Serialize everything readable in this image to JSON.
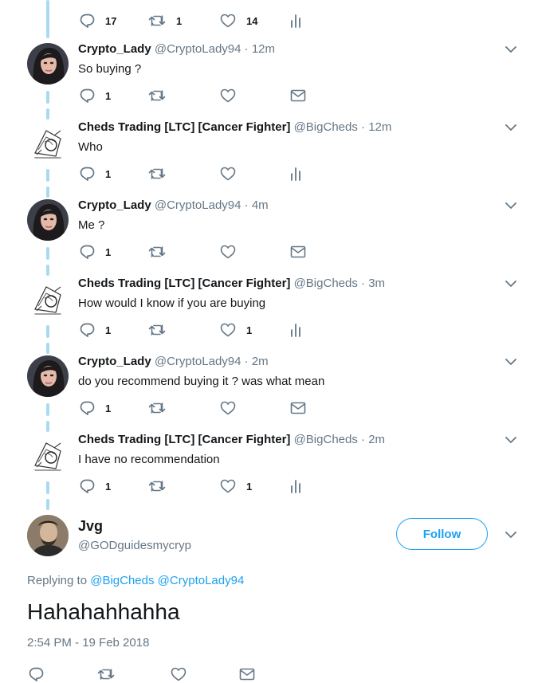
{
  "top_actions": {
    "replies": "17",
    "retweets": "1",
    "likes": "14"
  },
  "replies": [
    {
      "name": "Crypto_Lady",
      "handle": "@CryptoLady94",
      "time": "· 12m",
      "text": "So buying ?",
      "reply_count": "1",
      "like_count": "",
      "avatar": "crypto-lady",
      "extra_icon": "dm-icon"
    },
    {
      "name": "Cheds Trading [LTC] [Cancer Fighter]",
      "handle": "@BigCheds",
      "time": "· 12m",
      "text": "Who",
      "reply_count": "1",
      "like_count": "",
      "avatar": "cheds",
      "extra_icon": "analytics-icon"
    },
    {
      "name": "Crypto_Lady",
      "handle": "@CryptoLady94",
      "time": "· 4m",
      "text": "Me ?",
      "reply_count": "1",
      "like_count": "",
      "avatar": "crypto-lady",
      "extra_icon": "dm-icon"
    },
    {
      "name": "Cheds Trading [LTC] [Cancer Fighter]",
      "handle": "@BigCheds",
      "time": "· 3m",
      "text": "How would I know if you are buying",
      "reply_count": "1",
      "like_count": "1",
      "avatar": "cheds",
      "extra_icon": "analytics-icon"
    },
    {
      "name": "Crypto_Lady",
      "handle": "@CryptoLady94",
      "time": "· 2m",
      "text": "do you recommend buying it ? was what mean",
      "reply_count": "1",
      "like_count": "",
      "avatar": "crypto-lady",
      "extra_icon": "dm-icon"
    },
    {
      "name": "Cheds Trading [LTC] [Cancer Fighter]",
      "handle": "@BigCheds",
      "time": "· 2m",
      "text": "I have no recommendation",
      "reply_count": "1",
      "like_count": "1",
      "avatar": "cheds",
      "extra_icon": "analytics-icon"
    }
  ],
  "main_tweet": {
    "name": "Jvg",
    "handle": "@GODguidesmycryp",
    "follow_label": "Follow",
    "replying_prefix": "Replying to",
    "replying_to": [
      "@BigCheds",
      "@CryptoLady94"
    ],
    "text": "Hahahahhahha",
    "timestamp": "2:54 PM - 19 Feb 2018"
  },
  "colors": {
    "accent": "#1da1f2",
    "secondary_text": "#657786",
    "thread_line": "#a8dbf0"
  }
}
